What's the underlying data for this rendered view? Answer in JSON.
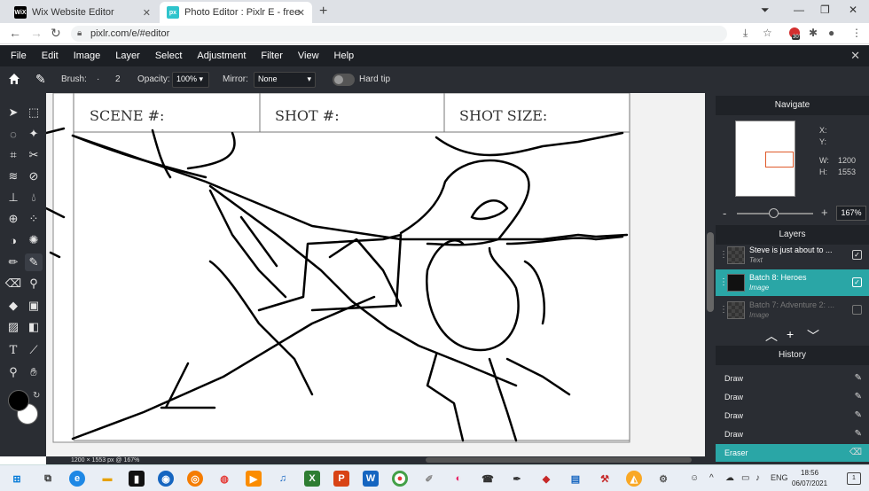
{
  "browser": {
    "tabs": [
      {
        "favicon": "WiX",
        "title": "Wix Website Editor",
        "close": "✕"
      },
      {
        "favicon": "px",
        "title": "Photo Editor : Pixlr E - free image",
        "close": "✕"
      }
    ],
    "new_tab": "+",
    "url": "pixlr.com/e/#editor",
    "extension_badge": "30"
  },
  "menubar": {
    "items": [
      "File",
      "Edit",
      "Image",
      "Layer",
      "Select",
      "Adjustment",
      "Filter",
      "View",
      "Help"
    ],
    "close": "✕"
  },
  "options": {
    "brush_label": "Brush:",
    "brush_dot": "·",
    "brush_size": "2",
    "opacity_label": "Opacity:",
    "opacity_value": "100%",
    "mirror_label": "Mirror:",
    "mirror_value": "None",
    "hardtip_label": "Hard tip"
  },
  "canvas": {
    "header_cells": [
      "SCENE #:",
      "SHOT #:",
      "SHOT SIZE:"
    ]
  },
  "status": {
    "text": "1200 × 1553 px @ 167%"
  },
  "navigate": {
    "title": "Navigate",
    "x_label": "X:",
    "y_label": "Y:",
    "w_label": "W:",
    "w_value": "1200",
    "h_label": "H:",
    "h_value": "1553",
    "zoom": "167%",
    "minus": "-",
    "plus": "+"
  },
  "layers": {
    "title": "Layers",
    "items": [
      {
        "name": "Steve is just about to ...",
        "type": "Text",
        "visible": true
      },
      {
        "name": "Batch 8: Heroes",
        "type": "Image",
        "visible": true,
        "active": true
      },
      {
        "name": "Batch 7: Adventure 2: ...",
        "type": "Image",
        "visible": false
      }
    ],
    "controls": [
      "︿",
      "+",
      "﹀"
    ]
  },
  "history": {
    "title": "History",
    "items": [
      "Draw",
      "Draw",
      "Draw",
      "Draw",
      "Eraser"
    ]
  },
  "taskbar": {
    "lang": "ENG",
    "time": "18:56",
    "date": "06/07/2021",
    "notifications": "1"
  },
  "colors": {
    "accent": "#2aa6a6",
    "panel": "#2a2d33",
    "menubar": "#1c1f24"
  }
}
